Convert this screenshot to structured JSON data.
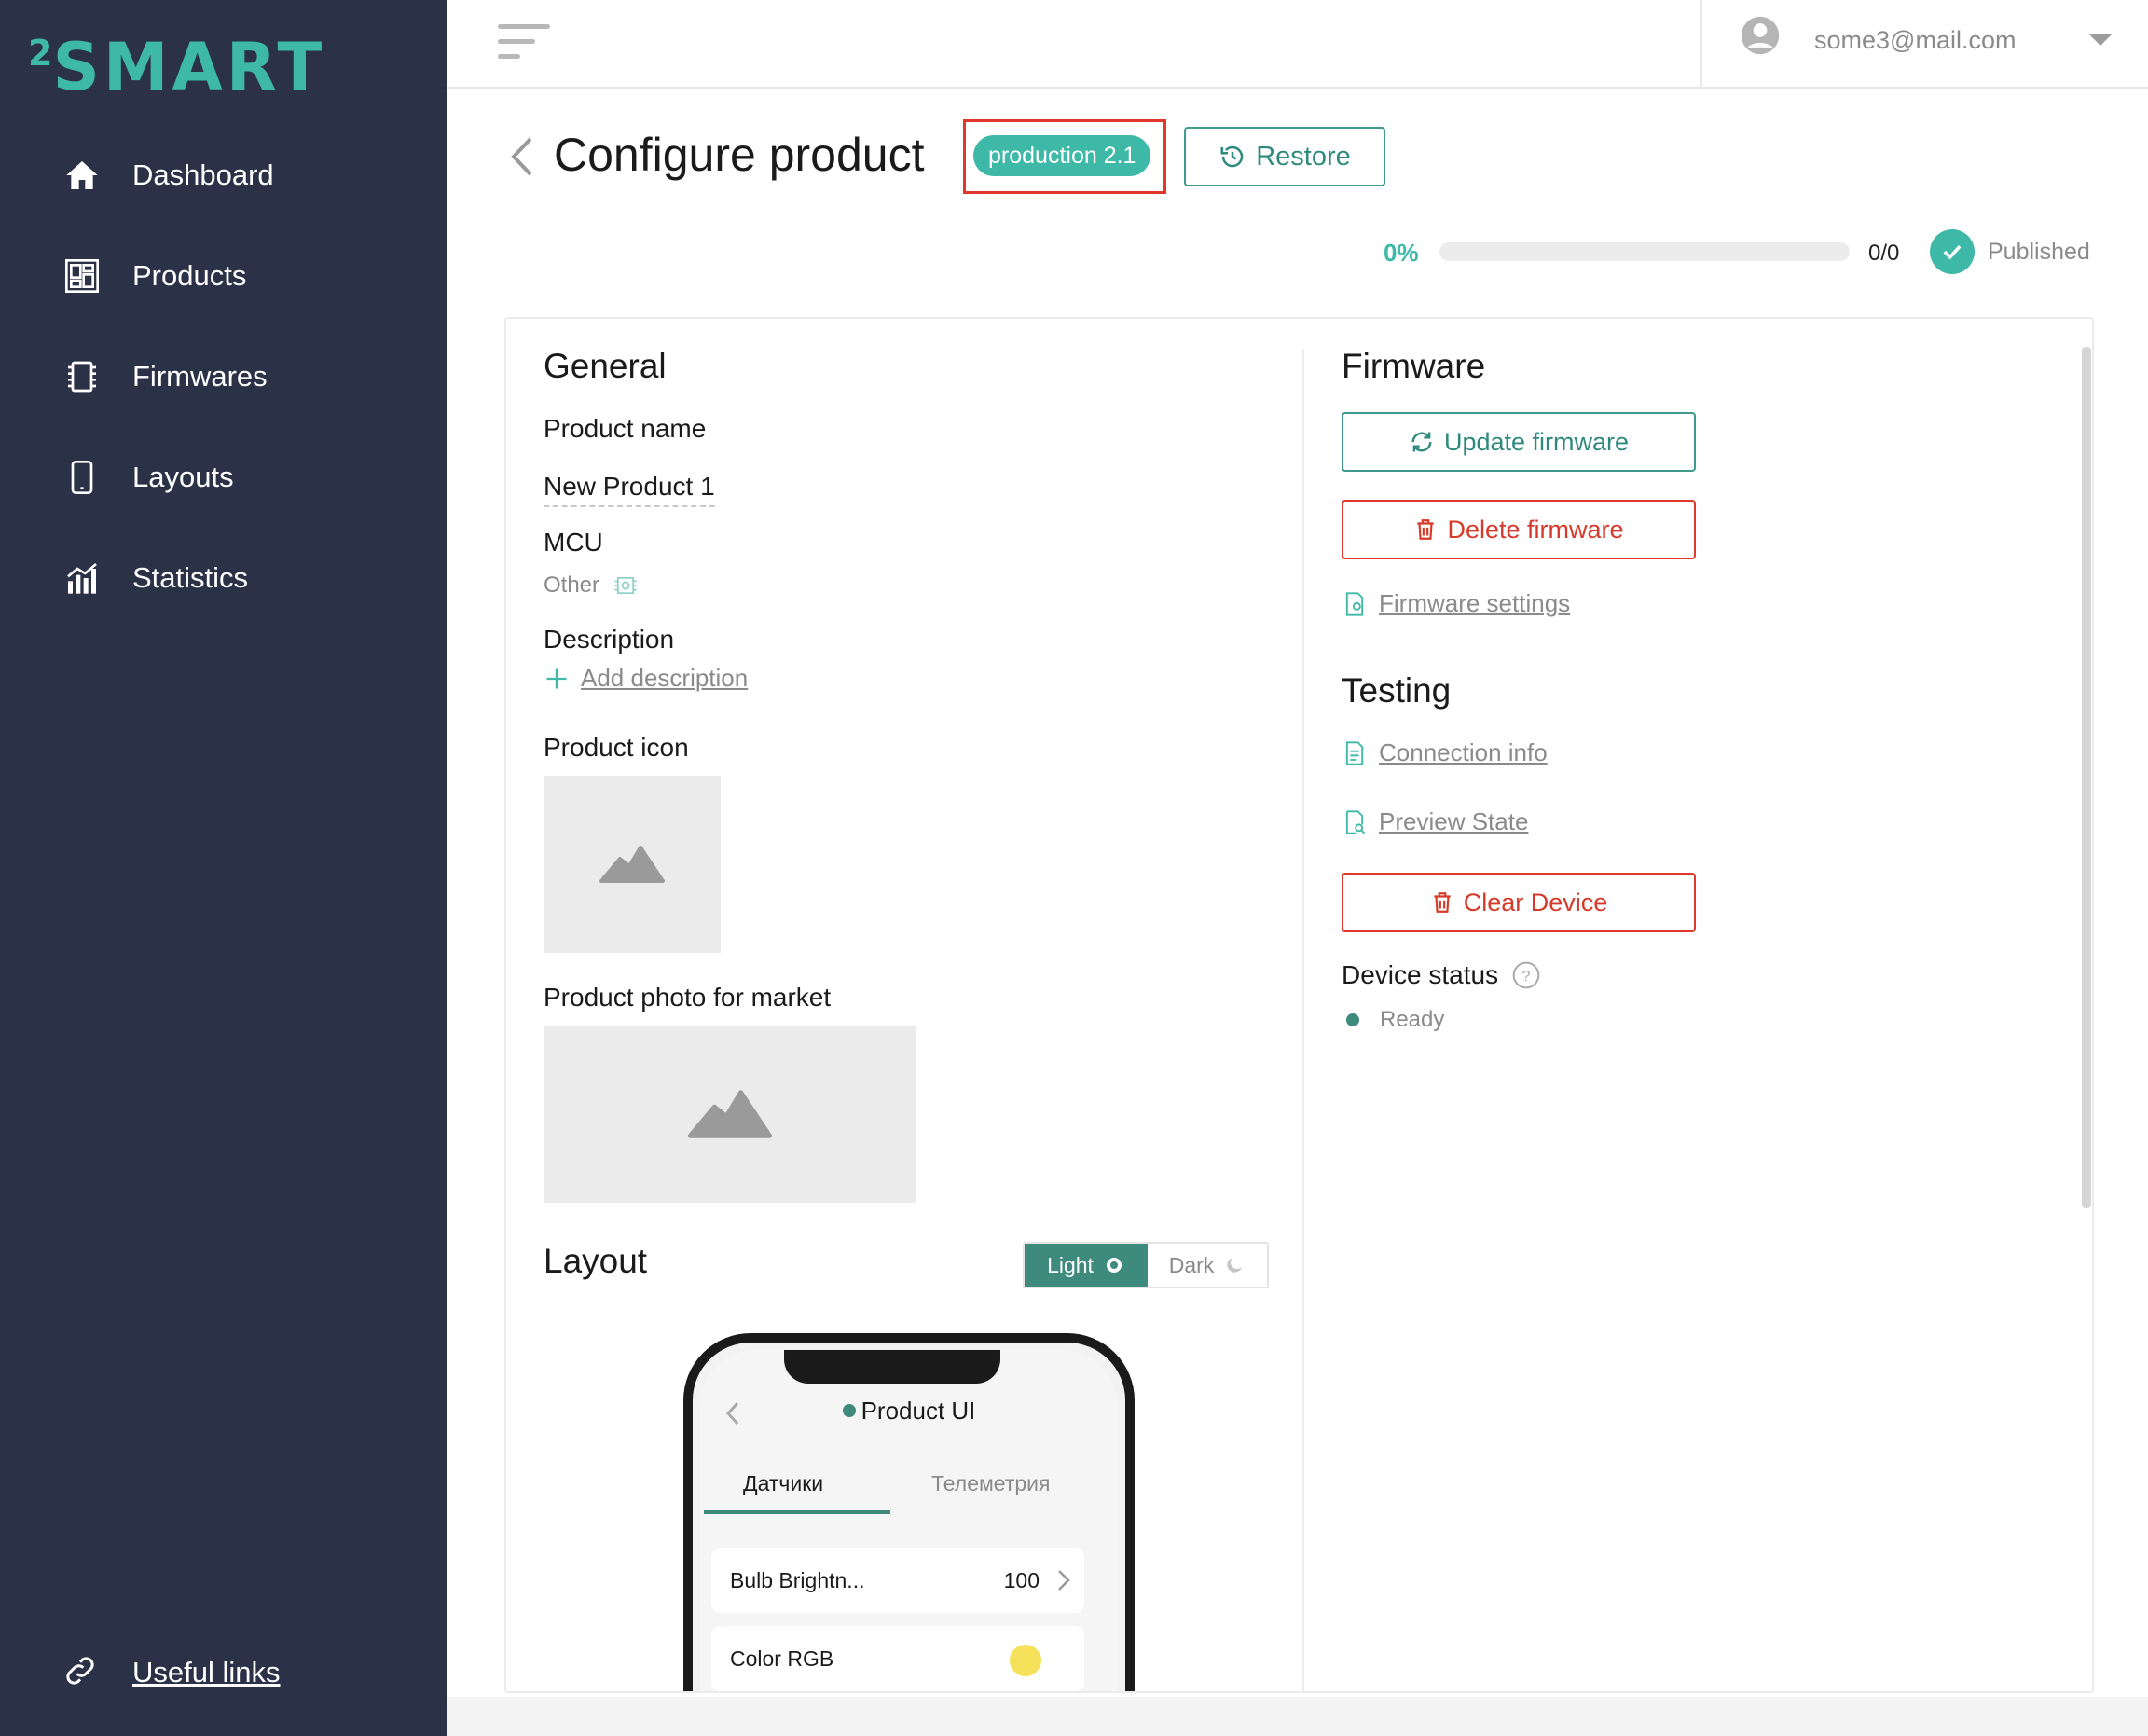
{
  "brand": {
    "logo_sup": "2",
    "logo_text": "SMART",
    "accent": "#3eb8a7",
    "sidebar_bg": "#2b3248"
  },
  "sidebar": {
    "items": [
      {
        "label": "Dashboard",
        "icon": "home-icon"
      },
      {
        "label": "Products",
        "icon": "products-icon"
      },
      {
        "label": "Firmwares",
        "icon": "chip-icon"
      },
      {
        "label": "Layouts",
        "icon": "phone-icon"
      },
      {
        "label": "Statistics",
        "icon": "chart-icon"
      }
    ],
    "useful_links": "Useful links"
  },
  "header": {
    "user_email": "some3@mail.com"
  },
  "page": {
    "title": "Configure product",
    "version_badge": "production 2.1",
    "restore_label": "Restore",
    "progress_percent": "0%",
    "progress_value": 0,
    "count": "0/0",
    "status": "Published"
  },
  "general": {
    "title": "General",
    "product_name_label": "Product name",
    "product_name_value": "New Product 1",
    "mcu_label": "MCU",
    "mcu_value": "Other",
    "description_label": "Description",
    "add_description": "Add description",
    "product_icon_label": "Product icon",
    "product_photo_label": "Product photo for market"
  },
  "layout": {
    "title": "Layout",
    "light_label": "Light",
    "dark_label": "Dark",
    "phone": {
      "title": "Product UI",
      "tab_1": "Датчики",
      "tab_2": "Телеметрия",
      "row_1_label": "Bulb Brightn...",
      "row_1_value": "100",
      "row_2_label": "Color RGB"
    }
  },
  "firmware": {
    "title": "Firmware",
    "update_label": "Update firmware",
    "delete_label": "Delete firmware",
    "settings_link": "Firmware settings"
  },
  "testing": {
    "title": "Testing",
    "connection_info": "Connection info",
    "preview_state": "Preview State",
    "clear_device": "Clear Device",
    "device_status_label": "Device status",
    "device_status_value": "Ready"
  }
}
